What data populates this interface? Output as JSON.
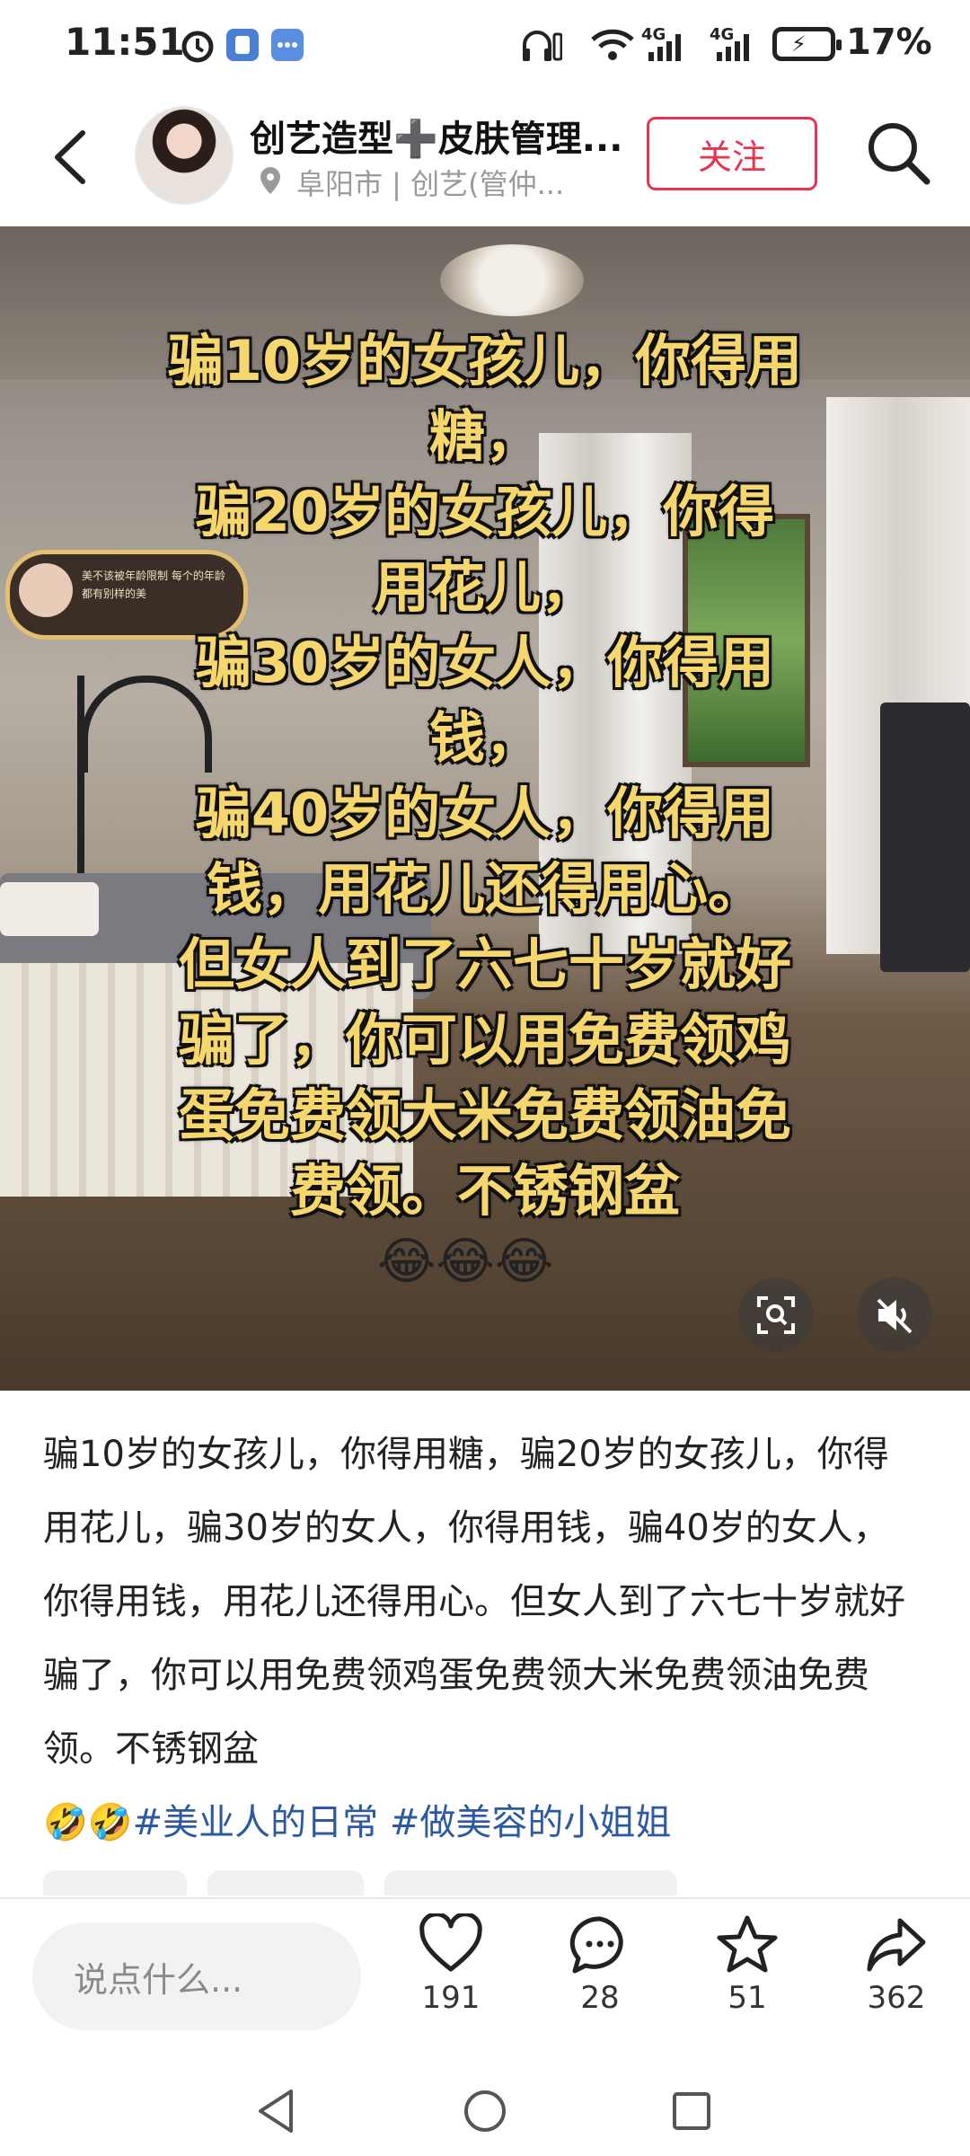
{
  "status_bar": {
    "time": "11:51",
    "battery_percent": "17%",
    "signal_1": "4G",
    "signal_2": "4G"
  },
  "header": {
    "account_name": "创艺造型➕皮肤管理...",
    "location": "阜阳市 | 创艺(管仲...",
    "follow_label": "关注"
  },
  "post_image": {
    "overlay_text": "骗10岁的女孩儿，你得用\n糖，\n骗20岁的女孩儿，你得\n用花儿，\n骗30岁的女人，你得用\n钱，\n骗40岁的女人，你得用\n钱，用花儿还得用心。\n但女人到了六七十岁就好\n骗了，你可以用免费领鸡\n蛋免费领大米免费领油免\n费领。不锈钢盆",
    "emojis": "😂😂😂",
    "sign_text": "美不该被年龄限制 每个的年龄都有别样的美"
  },
  "caption": {
    "text": "骗10岁的女孩儿，你得用糖，骗20岁的女孩儿，你得用花儿，骗30岁的女人，你得用钱，骗40岁的女人，你得用钱，用花儿还得用心。但女人到了六七十岁就好骗了，你可以用免费领鸡蛋免费领大米免费领油免费领。不锈钢盆",
    "emojis": "🤣🤣",
    "tags": [
      "#美业人的日常",
      "#做美容的小姐姐"
    ]
  },
  "bottom_bar": {
    "comment_placeholder": "说点什么...",
    "like_count": "191",
    "comment_count": "28",
    "favorite_count": "51",
    "share_count": "362"
  },
  "colors": {
    "accent_red": "#e8344e",
    "tag_blue": "#2c5aa0",
    "overlay_yellow": "#f6d76d"
  }
}
